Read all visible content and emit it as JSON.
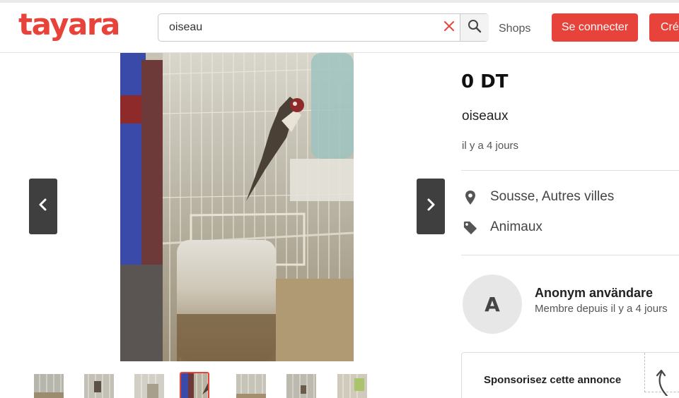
{
  "header": {
    "logo": "tayara",
    "search": {
      "value": "oiseau",
      "placeholder": ""
    },
    "shops_label": "Shops",
    "login_label": "Se connecter",
    "create_label": "Cré"
  },
  "listing": {
    "price": "0 DT",
    "title": "oiseaux",
    "posted": "il y a 4 jours",
    "location": "Sousse, Autres villes",
    "category": "Animaux"
  },
  "seller": {
    "initial": "A",
    "name": "Anonym användare",
    "since": "Membre depuis il y a 4 jours"
  },
  "sponsor": {
    "label": "Sponsorisez cette annonce"
  },
  "gallery": {
    "thumbnail_count": 7,
    "active_thumbnail": 4
  },
  "colors": {
    "brand": "#e8433a",
    "nav_button": "#3f3f3f"
  },
  "icons": {
    "clear": "close-icon",
    "search": "search-icon",
    "prev": "chevron-left-icon",
    "next": "chevron-right-icon",
    "location": "map-pin-icon",
    "category": "tag-icon"
  }
}
